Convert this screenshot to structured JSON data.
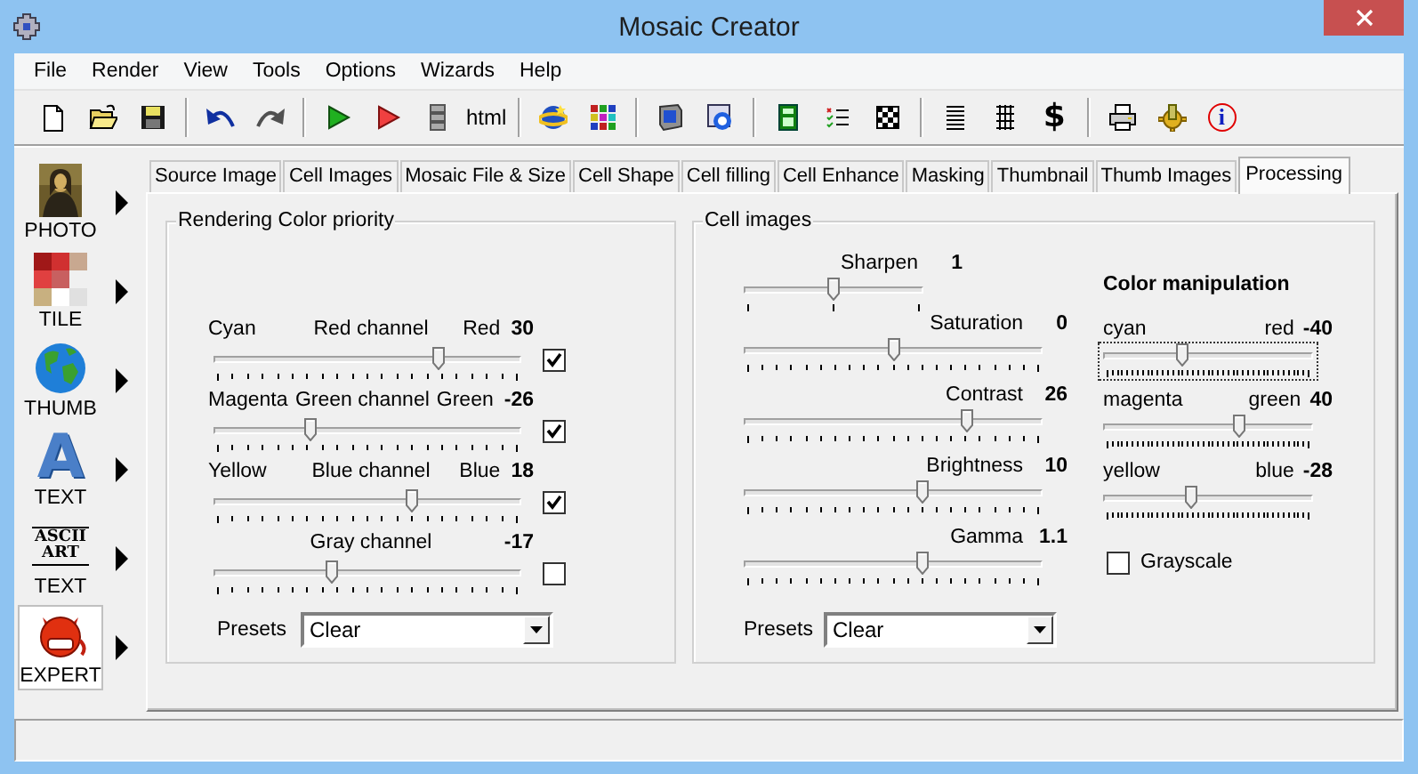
{
  "window": {
    "title": "Mosaic Creator"
  },
  "menu": [
    "File",
    "Render",
    "View",
    "Tools",
    "Options",
    "Wizards",
    "Help"
  ],
  "toolbar": {
    "html_label": "html",
    "dollar_label": "$",
    "info_label": "i"
  },
  "modes": [
    {
      "kind": "photo",
      "label": "PHOTO",
      "selected": false
    },
    {
      "kind": "tile",
      "label": "TILE",
      "selected": false
    },
    {
      "kind": "thumb",
      "label": "THUMB",
      "selected": false
    },
    {
      "kind": "text",
      "label": "TEXT",
      "icon_text": "A",
      "selected": false
    },
    {
      "kind": "ascii",
      "label": "TEXT",
      "icon_lines": [
        "ASCII",
        "ART"
      ],
      "selected": false
    },
    {
      "kind": "expert",
      "label": "EXPERT",
      "selected": true
    }
  ],
  "tabs": [
    {
      "label": "Source Image",
      "selected": false
    },
    {
      "label": "Cell Images",
      "selected": false
    },
    {
      "label": "Mosaic File & Size",
      "selected": false
    },
    {
      "label": "Cell Shape",
      "selected": false
    },
    {
      "label": "Cell filling",
      "selected": false
    },
    {
      "label": "Cell Enhance",
      "selected": false
    },
    {
      "label": "Masking",
      "selected": false
    },
    {
      "label": "Thumbnail",
      "selected": false
    },
    {
      "label": "Thumb Images",
      "selected": false
    },
    {
      "label": "Processing",
      "selected": true
    }
  ],
  "rendering_panel": {
    "title": "Rendering Color priority",
    "channels": [
      {
        "left": "Cyan",
        "name": "Red channel",
        "right": "Red",
        "value": "30",
        "level": 0.74,
        "checked": true
      },
      {
        "left": "Magenta",
        "name": "Green channel",
        "right": "Green",
        "value": "-26",
        "level": 0.31,
        "checked": true
      },
      {
        "left": "Yellow",
        "name": "Blue channel",
        "right": "Blue",
        "value": "18",
        "level": 0.65,
        "checked": true
      },
      {
        "name": "Gray channel",
        "value": "-17",
        "level": 0.38,
        "checked": false
      }
    ],
    "presets": {
      "label": "Presets",
      "value": "Clear"
    }
  },
  "cell_images_panel": {
    "title": "Cell images",
    "adjustments": [
      {
        "kind": "coarse",
        "name": "Sharpen",
        "value": "1",
        "level": 0.5
      },
      {
        "kind": "fine",
        "name": "Saturation",
        "value": "0",
        "level": 0.5
      },
      {
        "kind": "fine",
        "name": "Contrast",
        "value": "26",
        "level": 0.76
      },
      {
        "kind": "fine",
        "name": "Brightness",
        "value": "10",
        "level": 0.6
      },
      {
        "kind": "fine",
        "name": "Gamma",
        "value": "1.1",
        "level": 0.6
      }
    ],
    "color_manipulation": {
      "title": "Color manipulation",
      "sliders": [
        {
          "left": "cyan",
          "right": "red",
          "value": "-40",
          "level": 0.37,
          "focused": true
        },
        {
          "left": "magenta",
          "right": "green",
          "value": "40",
          "level": 0.66,
          "focused": false
        },
        {
          "left": "yellow",
          "right": "blue",
          "value": "-28",
          "level": 0.41,
          "focused": false
        }
      ]
    },
    "grayscale": {
      "label": "Grayscale",
      "checked": false
    },
    "presets": {
      "label": "Presets",
      "value": "Clear"
    }
  }
}
